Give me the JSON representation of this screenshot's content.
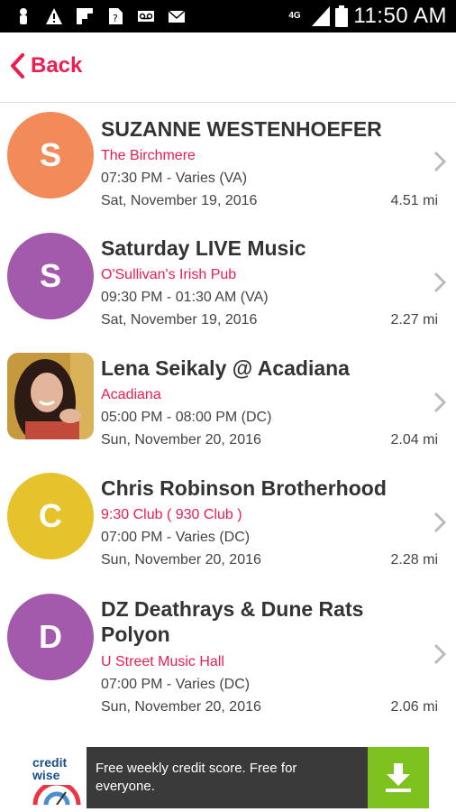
{
  "status_bar": {
    "time": "11:50 AM",
    "network": "4G",
    "icons": [
      "person-icon",
      "warning-icon",
      "flipboard-icon",
      "sim-icon",
      "voicemail-icon",
      "mail-icon",
      "signal-icon",
      "battery-icon"
    ]
  },
  "header": {
    "back_label": "Back",
    "accent_color": "#ec1d4f"
  },
  "events": [
    {
      "initial": "S",
      "avatar_color": "#f38a5a",
      "title": "SUZANNE WESTENHOEFER",
      "venue": "The Birchmere",
      "time": "07:30 PM - Varies (VA)",
      "date": "Sat, November 19, 2016",
      "distance": "4.51 mi"
    },
    {
      "initial": "S",
      "avatar_color": "#a45aac",
      "title": "Saturday LIVE Music",
      "venue": "O'Sullivan's Irish Pub",
      "time": "09:30 PM - 01:30 AM (VA)",
      "date": "Sat, November 19, 2016",
      "distance": "2.27 mi"
    },
    {
      "initial": "",
      "avatar_color": "photo",
      "title": "Lena Seikaly @ Acadiana",
      "venue": "Acadiana",
      "time": "05:00 PM - 08:00 PM (DC)",
      "date": "Sun, November 20, 2016",
      "distance": "2.04 mi"
    },
    {
      "initial": "C",
      "avatar_color": "#e6c22c",
      "title": "Chris Robinson Brotherhood",
      "venue": "9:30 Club ( 930 Club )",
      "time": "07:00 PM - Varies (DC)",
      "date": "Sun, November 20, 2016",
      "distance": "2.28 mi"
    },
    {
      "initial": "D",
      "avatar_color": "#a45aac",
      "title": "DZ Deathrays & Dune Rats Polyon",
      "venue": "U Street Music Hall",
      "time": "07:00 PM - Varies (DC)",
      "date": "Sun, November 20, 2016",
      "distance": "2.06 mi"
    }
  ],
  "ad": {
    "logo_text": "credit wise",
    "text": "Free weekly credit score. Free for everyone.",
    "button_icon": "download-icon"
  }
}
